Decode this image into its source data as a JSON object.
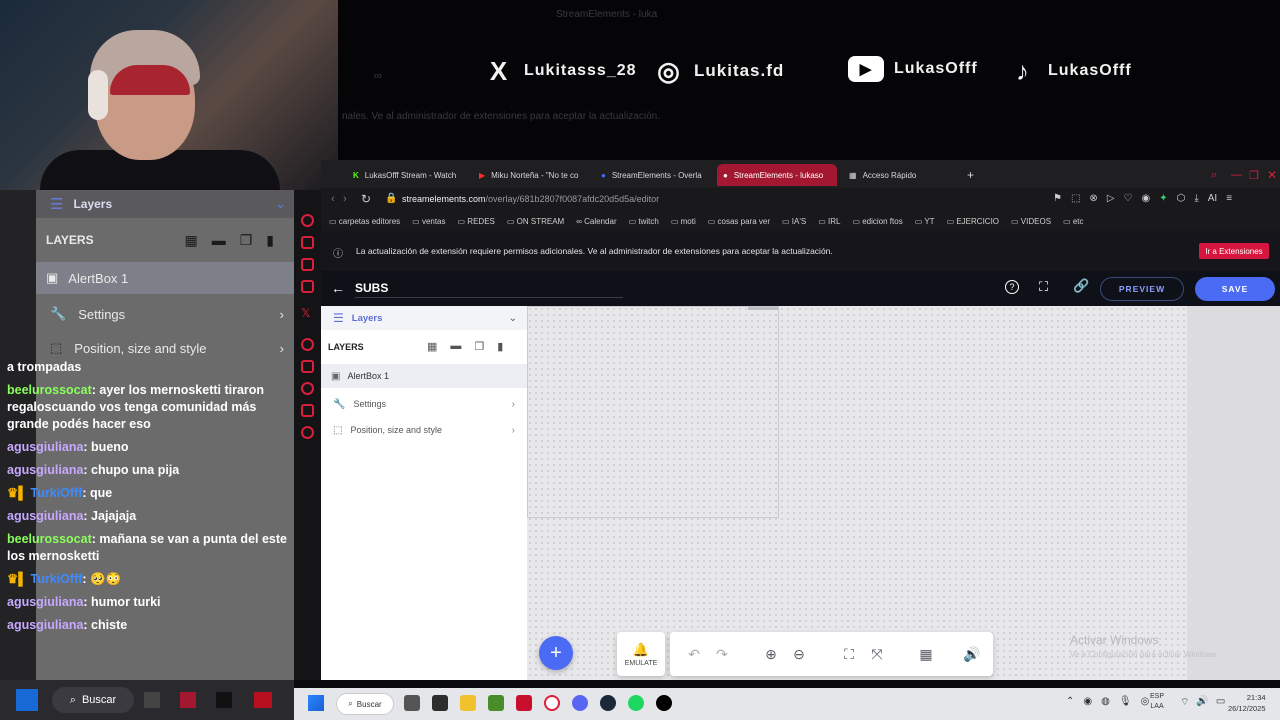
{
  "webcam": {},
  "banner": {
    "socials": [
      {
        "icon": "x-logo-icon",
        "glyph": "X",
        "handle": "Lukitasss_28"
      },
      {
        "icon": "instagram-icon",
        "glyph": "◎",
        "handle": "Lukitas.fd"
      },
      {
        "icon": "youtube-icon",
        "glyph": "▶",
        "handle": "LukasOfff"
      },
      {
        "icon": "tiktok-icon",
        "glyph": "♪",
        "handle": "LukasOfff"
      }
    ],
    "ghost_title": "StreamElements - luka",
    "ghost_notice": "nales. Ve al administrador de extensiones para aceptar la actualización."
  },
  "stream_panel": {
    "layers_title": "Layers",
    "layers_heading": "LAYERS",
    "alertbox": "AlertBox 1",
    "settings": "Settings",
    "position": "Position, size and style"
  },
  "chat": {
    "messages": [
      {
        "user": "",
        "text": "a trompadas",
        "color": "none"
      },
      {
        "user": "beelurossocat",
        "text": " ayer los mernosketti tiraron regaloscuando vos tenga comunidad más grande podés hacer eso",
        "color": "green"
      },
      {
        "user": "agusgiuliana",
        "text": " bueno",
        "color": "purple"
      },
      {
        "user": "agusgiuliana",
        "text": " chupo una pija",
        "color": "purple"
      },
      {
        "user": "TurkiOfff",
        "text": " que",
        "color": "blue"
      },
      {
        "user": "agusgiuliana",
        "text": " Jajajaja",
        "color": "purple"
      },
      {
        "user": "beelurossocat",
        "text": " mañana se van a punta del este los mernosketti",
        "color": "green"
      },
      {
        "user": "TurkiOfff",
        "text": " 🥺😳",
        "color": "blue"
      },
      {
        "user": "agusgiuliana",
        "text": " humor turki",
        "color": "purple"
      },
      {
        "user": "agusgiuliana",
        "text": " chiste",
        "color": "purple"
      }
    ]
  },
  "browser": {
    "tabs": [
      {
        "label": "LukasOfff Stream - Watch",
        "active": false
      },
      {
        "label": "Miku Norteña - \"No te co",
        "active": false
      },
      {
        "label": "StreamElements - Overla",
        "active": false
      },
      {
        "label": "StreamElements - lukaso",
        "active": true
      },
      {
        "label": "Acceso Rápido",
        "active": false
      }
    ],
    "url_host": "streamelements.com",
    "url_path": "/overlay/681b2807f0087afdc20d5d5a/editor",
    "bookmarks": [
      "carpetas editores",
      "ventas",
      "REDES",
      "ON STREAM",
      "Calendar",
      "twitch",
      "moti",
      "cosas para ver",
      "IA'S",
      "IRL",
      "edicion ftos",
      "YT",
      "EJERCICIO",
      "VIDEOS",
      "etc"
    ],
    "notice_text": "La actualización de extensión requiere permisos adicionales. Ve al administrador de extensiones para aceptar la actualización.",
    "notice_button": "Ir a Extensiones",
    "ai_label": "AI"
  },
  "editor": {
    "title": "SUBS",
    "preview": "PREVIEW",
    "save": "SAVE",
    "layers_title": "Layers",
    "layers_heading": "LAYERS",
    "alertbox": "AlertBox 1",
    "settings": "Settings",
    "position": "Position, size and style",
    "emulate": "EMULATE",
    "watermark_title": "Activar Windows",
    "watermark_sub": "Ve a Configuración para activar Windows."
  },
  "taskbar": {
    "search": "Buscar",
    "left_search": "Buscar",
    "lang_top": "ESP",
    "lang_bottom": "LAA",
    "time": "21:34",
    "date": "26/12/2025"
  },
  "colors": {
    "accent": "#3b5bdb",
    "red": "#d81f3c",
    "notice_btn": "#d7163f"
  }
}
